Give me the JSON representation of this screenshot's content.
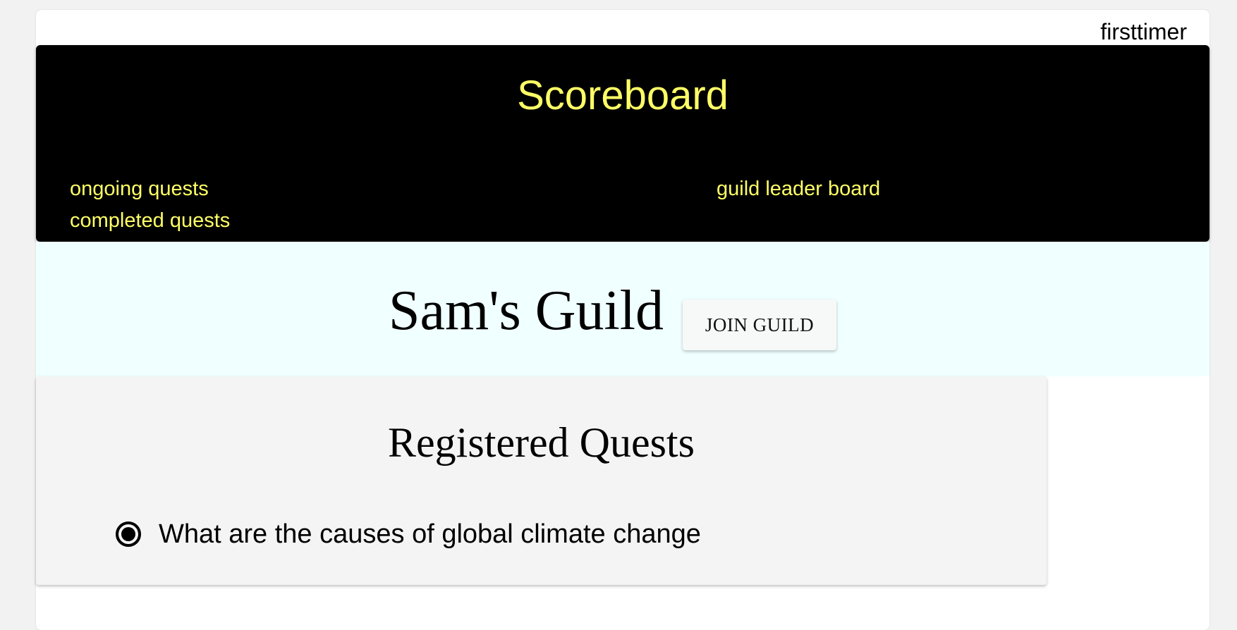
{
  "user": {
    "username": "firsttimer"
  },
  "header": {
    "title": "Scoreboard",
    "nav": {
      "ongoing": "ongoing quests",
      "completed": "completed quests",
      "leaderboard": "guild leader board"
    }
  },
  "guild": {
    "name": "Sam's Guild",
    "join_label": "JOIN GUILD"
  },
  "quests": {
    "title": "Registered Quests",
    "items": [
      {
        "label": "What are the causes of global climate change",
        "selected": true
      }
    ]
  },
  "colors": {
    "header_bg": "#000000",
    "header_text": "#ffff66",
    "banner_bg": "#f0ffff",
    "card_bg": "#f4f4f4"
  }
}
